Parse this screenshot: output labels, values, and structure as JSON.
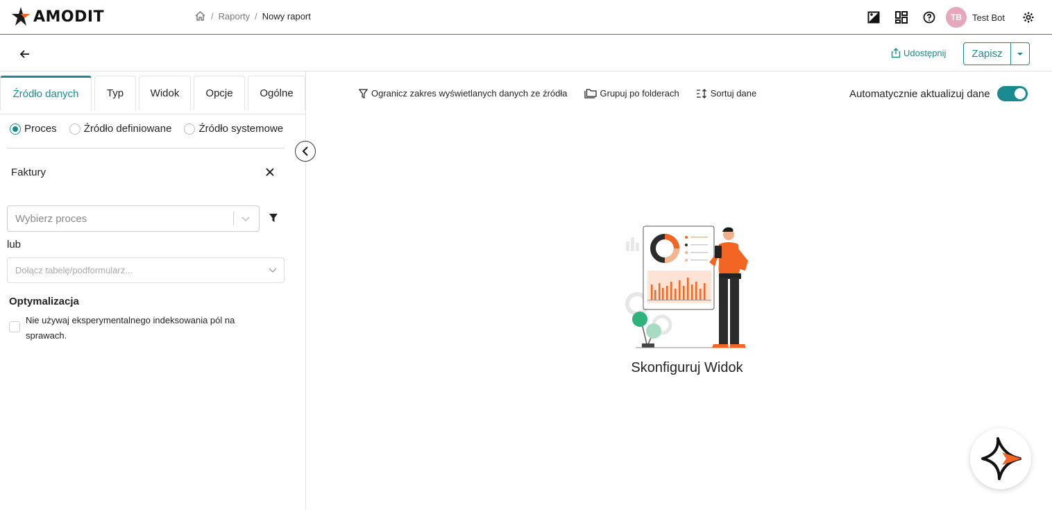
{
  "app": {
    "logo_text": "AMODIT"
  },
  "breadcrumb": {
    "items": [
      "Raporty",
      "Nowy raport"
    ],
    "separator": "/"
  },
  "user": {
    "initials": "TB",
    "name": "Test Bot"
  },
  "actions": {
    "share_label": "Udostępnij",
    "save_label": "Zapisz"
  },
  "tabs": [
    {
      "label": "Źródło danych",
      "active": true
    },
    {
      "label": "Typ",
      "active": false
    },
    {
      "label": "Widok",
      "active": false
    },
    {
      "label": "Opcje",
      "active": false
    },
    {
      "label": "Ogólne",
      "active": false
    }
  ],
  "source_options": [
    {
      "label": "Proces",
      "selected": true
    },
    {
      "label": "Źródło definiowane",
      "selected": false
    },
    {
      "label": "Źródło systemowe",
      "selected": false
    }
  ],
  "source": {
    "selected_name": "Faktury",
    "process_placeholder": "Wybierz proces",
    "or_label": "lub",
    "join_placeholder": "Dołącz tabelę/podformularz..."
  },
  "optimization": {
    "title": "Optymalizacja",
    "checkbox_label": "Nie używaj eksperymentalnego indeksowania pól na sprawach.",
    "checked": false
  },
  "toolbar": {
    "filter_label": "Ogranicz zakres wyświetlanych danych ze źródła",
    "group_label": "Grupuj po folderach",
    "sort_label": "Sortuj dane",
    "auto_update_label": "Automatycznie aktualizuj dane",
    "auto_update_on": true
  },
  "empty_state": {
    "title": "Skonfiguruj Widok"
  },
  "colors": {
    "accent": "#1a8a8f",
    "orange": "#f26522",
    "avatar": "#e6a7bd"
  }
}
